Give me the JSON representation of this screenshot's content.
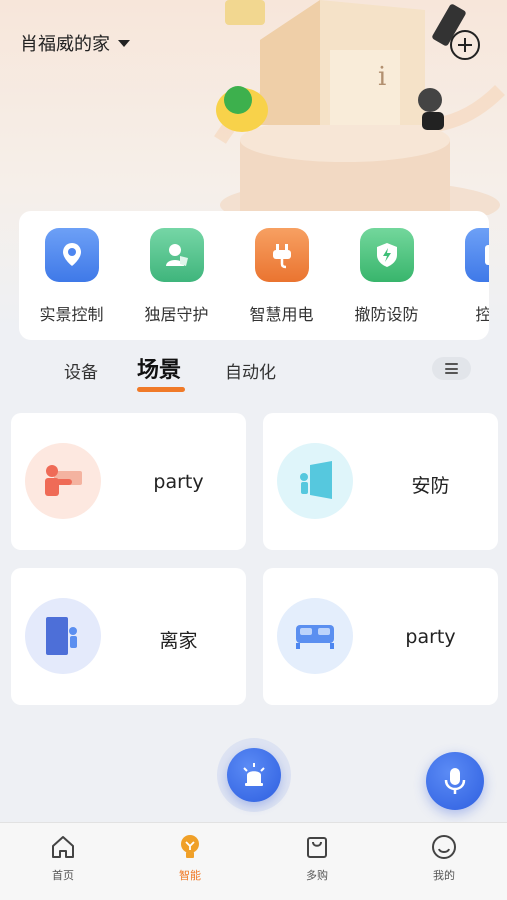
{
  "header": {
    "home_name": "肖福威的家",
    "caret_icon": "caret-down-icon",
    "add_icon": "plus-circle-icon"
  },
  "quick_actions": [
    {
      "label": "实景控制",
      "icon": "location-pin-icon",
      "color": "#4d86f0"
    },
    {
      "label": "独居守护",
      "icon": "person-shield-icon",
      "color": "#4cc08a"
    },
    {
      "label": "智慧用电",
      "icon": "plug-icon",
      "color": "#f08a3c"
    },
    {
      "label": "撤防设防",
      "icon": "shield-bolt-icon",
      "color": "#3fbf78"
    },
    {
      "label": "控制",
      "icon": "panel-icon",
      "color": "#4d86f0"
    }
  ],
  "tabs": [
    {
      "label": "设备"
    },
    {
      "label": "场景",
      "active": true
    },
    {
      "label": "自动化"
    }
  ],
  "scenes": [
    {
      "name": "party",
      "icon": "party-scene-icon",
      "color": "#f07a5a"
    },
    {
      "name": "安防",
      "icon": "security-door-icon",
      "color": "#48c2d8"
    },
    {
      "name": "离家",
      "icon": "leave-home-icon",
      "color": "#4d6fd8"
    },
    {
      "name": "party",
      "icon": "bed-icon",
      "color": "#4d86f0"
    }
  ],
  "fabs": {
    "alarm_icon": "alarm-siren-icon",
    "voice_icon": "microphone-icon"
  },
  "bottom_nav": [
    {
      "label": "首页",
      "icon": "home-icon"
    },
    {
      "label": "智能",
      "icon": "smart-bulb-icon",
      "active": true
    },
    {
      "label": "多购",
      "icon": "shopping-bag-icon"
    },
    {
      "label": "我的",
      "icon": "smiley-icon"
    }
  ],
  "colors": {
    "accent": "#f07a28",
    "primary_blue": "#3a6be8",
    "background": "#eef0f4"
  }
}
